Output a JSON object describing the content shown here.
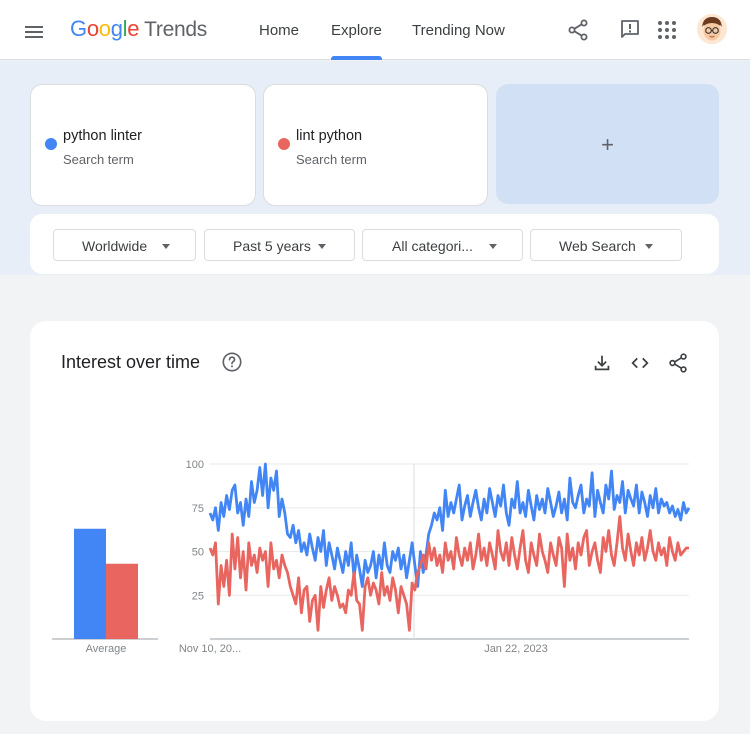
{
  "header": {
    "logo_letters": [
      "G",
      "o",
      "o",
      "g",
      "l",
      "e"
    ],
    "logo_suffix": "Trends",
    "nav": [
      "Home",
      "Explore",
      "Trending Now"
    ],
    "active_nav": "Explore",
    "icons": [
      "menu-icon",
      "share-icon",
      "feedback-icon",
      "apps-icon",
      "avatar"
    ]
  },
  "terms": [
    {
      "name": "python linter",
      "sub": "Search term",
      "color": "#4285f4"
    },
    {
      "name": "lint python",
      "sub": "Search term",
      "color": "#e8665f"
    }
  ],
  "add_term": {
    "label": "+"
  },
  "filters": [
    "Worldwide",
    "Past 5 years",
    "All categori...",
    "Web Search"
  ],
  "chart": {
    "title": "Interest over time",
    "icons": [
      "help-icon",
      "download-icon",
      "embed-icon",
      "share-icon"
    ]
  },
  "chart_data": {
    "type": "line",
    "title": "Interest over time",
    "ylim": [
      0,
      100
    ],
    "yticks": [
      25,
      50,
      75,
      100
    ],
    "x_labels": [
      "Nov 10, 20...",
      "Jan 22, 2023"
    ],
    "average_label": "Average",
    "averages": [
      {
        "name": "python linter",
        "value": 63
      },
      {
        "name": "lint python",
        "value": 43
      }
    ],
    "grid": true,
    "series": [
      {
        "name": "python linter",
        "color": "#4285f4",
        "values": [
          72,
          68,
          75,
          62,
          78,
          70,
          82,
          74,
          85,
          88,
          72,
          78,
          65,
          80,
          70,
          90,
          78,
          85,
          98,
          82,
          100,
          75,
          92,
          85,
          96,
          70,
          80,
          72,
          60,
          58,
          65,
          55,
          62,
          50,
          55,
          48,
          60,
          52,
          45,
          58,
          50,
          62,
          42,
          55,
          48,
          40,
          52,
          45,
          38,
          50,
          42,
          55,
          35,
          48,
          40,
          30,
          45,
          38,
          42,
          50,
          35,
          48,
          40,
          55,
          42,
          38,
          50,
          45,
          52,
          40,
          48,
          35,
          45,
          55,
          42,
          30,
          50,
          38,
          48,
          60,
          65,
          72,
          68,
          75,
          62,
          85,
          70,
          78,
          72,
          80,
          88,
          68,
          76,
          82,
          70,
          78,
          85,
          75,
          68,
          80,
          72,
          86,
          78,
          70,
          82,
          76,
          88,
          72,
          65,
          80,
          75,
          90,
          72,
          78,
          70,
          85,
          76,
          68,
          82,
          74,
          80,
          72,
          86,
          78,
          70,
          76,
          84,
          72,
          80,
          68,
          92,
          78,
          75,
          82,
          88,
          72,
          80,
          76,
          95,
          70,
          85,
          78,
          72,
          88,
          80,
          96,
          74,
          82,
          78,
          90,
          72,
          85,
          80,
          76,
          88,
          72,
          84,
          78,
          70,
          82,
          75,
          86,
          72,
          80,
          76,
          78,
          72,
          76,
          70,
          74,
          68,
          78,
          72,
          75
        ]
      },
      {
        "name": "lint python",
        "color": "#e8665f",
        "values": [
          52,
          48,
          55,
          20,
          42,
          30,
          45,
          25,
          60,
          40,
          58,
          35,
          50,
          28,
          55,
          42,
          48,
          38,
          52,
          45,
          50,
          30,
          55,
          40,
          45,
          35,
          48,
          42,
          38,
          30,
          25,
          20,
          35,
          15,
          28,
          30,
          10,
          22,
          25,
          5,
          30,
          18,
          28,
          35,
          22,
          30,
          25,
          18,
          20,
          15,
          28,
          25,
          38,
          22,
          20,
          5,
          30,
          35,
          25,
          32,
          28,
          20,
          38,
          25,
          30,
          22,
          35,
          28,
          15,
          30,
          25,
          20,
          5,
          32,
          28,
          38,
          42,
          48,
          40,
          55,
          45,
          52,
          42,
          48,
          38,
          55,
          45,
          50,
          40,
          58,
          48,
          42,
          52,
          45,
          55,
          40,
          48,
          60,
          45,
          52,
          42,
          55,
          48,
          40,
          62,
          50,
          45,
          55,
          42,
          58,
          48,
          40,
          52,
          62,
          45,
          38,
          55,
          48,
          42,
          60,
          50,
          45,
          38,
          55,
          48,
          42,
          58,
          52,
          30,
          60,
          45,
          52,
          40,
          55,
          48,
          58,
          62,
          42,
          50,
          55,
          45,
          38,
          58,
          50,
          62,
          48,
          42,
          55,
          70,
          52,
          45,
          60,
          50,
          42,
          55,
          48,
          58,
          45,
          52,
          62,
          50,
          45,
          55,
          48,
          52,
          42,
          58,
          50,
          45,
          55,
          48,
          50,
          52,
          52
        ]
      }
    ]
  }
}
